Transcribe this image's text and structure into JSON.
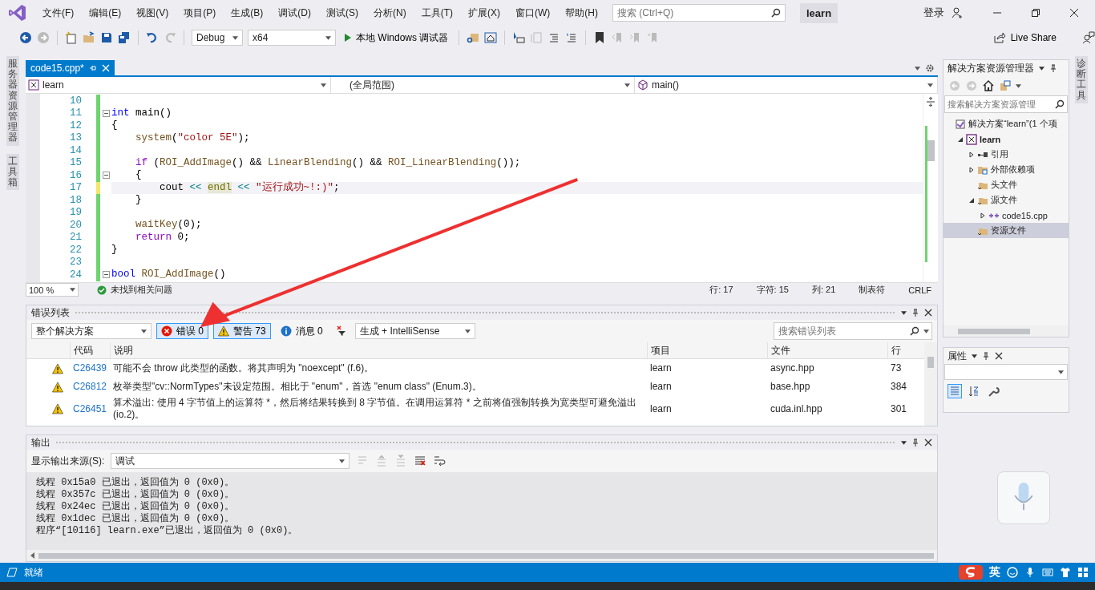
{
  "window": {
    "menu": [
      "文件(F)",
      "编辑(E)",
      "视图(V)",
      "项目(P)",
      "生成(B)",
      "调试(D)",
      "测试(S)",
      "分析(N)",
      "工具(T)",
      "扩展(X)",
      "窗口(W)",
      "帮助(H)"
    ],
    "search_placeholder": "搜索 (Ctrl+Q)",
    "title": "learn",
    "sign_in": "登录"
  },
  "toolbar": {
    "configuration": "Debug",
    "platform": "x64",
    "run_label": "本地 Windows 调试器",
    "live_share": "Live Share"
  },
  "side_tabs_left": [
    "服务器资源管理器",
    "工具箱"
  ],
  "side_tabs_right": [
    "诊断工具"
  ],
  "editor": {
    "tabs": [
      {
        "label": "code15.cpp*",
        "selected": true
      }
    ],
    "nav": {
      "project": "learn",
      "scope": "(全局范围)",
      "member": "main()"
    },
    "lines": [
      {
        "number": "10",
        "saved": true,
        "current": false,
        "fold": false
      },
      {
        "number": "11",
        "saved": true,
        "current": false,
        "fold": true,
        "tokens": [
          {
            "text": "int",
            "kind": "keyword"
          },
          {
            "text": " main()",
            "kind": "plain"
          }
        ]
      },
      {
        "number": "12",
        "saved": true,
        "current": false,
        "fold": false,
        "tokens": [
          {
            "text": "{",
            "kind": "plain"
          }
        ]
      },
      {
        "number": "13",
        "saved": true,
        "current": false,
        "fold": false,
        "tokens": [
          {
            "text": "    system",
            "kind": "func"
          },
          {
            "text": "(",
            "kind": "plain"
          },
          {
            "text": "\"color 5E\"",
            "kind": "string"
          },
          {
            "text": ");",
            "kind": "plain"
          }
        ]
      },
      {
        "number": "14",
        "saved": true,
        "current": false,
        "fold": false
      },
      {
        "number": "15",
        "saved": true,
        "current": false,
        "fold": false,
        "tokens": [
          {
            "text": "    if",
            "kind": "control"
          },
          {
            "text": " (",
            "kind": "plain"
          },
          {
            "text": "ROI_AddImage",
            "kind": "func"
          },
          {
            "text": "() && ",
            "kind": "plain"
          },
          {
            "text": "LinearBlending",
            "kind": "func"
          },
          {
            "text": "() && ",
            "kind": "plain"
          },
          {
            "text": "ROI_LinearBlending",
            "kind": "func"
          },
          {
            "text": "());",
            "kind": "plain"
          }
        ]
      },
      {
        "number": "16",
        "saved": true,
        "current": false,
        "fold": true,
        "tokens": [
          {
            "text": "    {",
            "kind": "plain"
          }
        ]
      },
      {
        "number": "17",
        "saved": false,
        "current": true,
        "fold": false,
        "tokens": [
          {
            "text": "        cout ",
            "kind": "plain"
          },
          {
            "text": "<< ",
            "kind": "operator"
          },
          {
            "text": "endl",
            "kind": "highlight"
          },
          {
            "text": " << ",
            "kind": "operator"
          },
          {
            "text": "\"运行成功~!:)\"",
            "kind": "string"
          },
          {
            "text": ";",
            "kind": "plain"
          }
        ]
      },
      {
        "number": "18",
        "saved": true,
        "current": false,
        "fold": false,
        "tokens": [
          {
            "text": "    }",
            "kind": "plain"
          }
        ]
      },
      {
        "number": "19",
        "saved": true,
        "current": false,
        "fold": false
      },
      {
        "number": "20",
        "saved": true,
        "current": false,
        "fold": false,
        "tokens": [
          {
            "text": "    waitKey",
            "kind": "func"
          },
          {
            "text": "(0);",
            "kind": "plain"
          }
        ]
      },
      {
        "number": "21",
        "saved": true,
        "current": false,
        "fold": false,
        "tokens": [
          {
            "text": "    return",
            "kind": "control"
          },
          {
            "text": " 0;",
            "kind": "plain"
          }
        ]
      },
      {
        "number": "22",
        "saved": true,
        "current": false,
        "fold": false,
        "tokens": [
          {
            "text": "}",
            "kind": "plain"
          }
        ]
      },
      {
        "number": "23",
        "saved": true,
        "current": false,
        "fold": false
      },
      {
        "number": "24",
        "saved": true,
        "current": false,
        "fold": true,
        "tokens": [
          {
            "text": "bool ",
            "kind": "keyword"
          },
          {
            "text": "ROI_AddImage",
            "kind": "func"
          },
          {
            "text": "()",
            "kind": "plain"
          }
        ]
      }
    ],
    "status": {
      "zoom": "100 %",
      "issues": "未找到相关问题",
      "line": "行: 17",
      "char": "字符: 15",
      "col": "列: 21",
      "tabs": "制表符",
      "eol": "CRLF"
    }
  },
  "error_list": {
    "title": "错误列表",
    "scope": "整个解决方案",
    "filters": [
      {
        "kind": "error",
        "label": "错误 0",
        "on": true
      },
      {
        "kind": "warning",
        "label": "警告 73",
        "on": true
      },
      {
        "kind": "message",
        "label": "消息 0",
        "on": false
      }
    ],
    "source": "生成 + IntelliSense",
    "search_placeholder": "搜索错误列表",
    "columns": [
      "代码",
      "说明",
      "项目",
      "文件",
      "行"
    ],
    "rows": [
      {
        "kind": "warning",
        "code": "C26439",
        "description": "可能不会 throw 此类型的函数。将其声明为 \"noexcept\" (f.6)。",
        "project": "learn",
        "file": "async.hpp",
        "line": "73"
      },
      {
        "kind": "warning",
        "code": "C26812",
        "description": "枚举类型\"cv::NormTypes\"未设定范围。相比于 \"enum\"，首选 \"enum class\" (Enum.3)。",
        "project": "learn",
        "file": "base.hpp",
        "line": "384"
      },
      {
        "kind": "warning",
        "code": "C26451",
        "description": "算术溢出: 使用 4 字节值上的运算符 *，然后将结果转换到 8 字节值。在调用运算符 * 之前将值强制转换为宽类型可避免溢出 (io.2)。",
        "project": "learn",
        "file": "cuda.inl.hpp",
        "line": "301"
      }
    ]
  },
  "output": {
    "title": "输出",
    "source_label": "显示输出来源(S):",
    "source": "调试",
    "lines": [
      "线程 0x15a0 已退出，返回值为 0 (0x0)。",
      "线程 0x357c 已退出，返回值为 0 (0x0)。",
      "线程 0x24ec 已退出，返回值为 0 (0x0)。",
      "线程 0x1dec 已退出，返回值为 0 (0x0)。",
      "程序“[10116] learn.exe”已退出，返回值为 0 (0x0)。"
    ]
  },
  "solution_explorer": {
    "title": "解决方案资源管理器",
    "search_placeholder": "搜索解决方案资源管理",
    "tree": [
      {
        "label": "解决方案“learn”(1 个项",
        "kind": "solution",
        "selected": false,
        "children": [
          {
            "label": "learn",
            "kind": "project",
            "selected": false,
            "expanded": true,
            "children": [
              {
                "label": "引用",
                "kind": "references",
                "selected": false,
                "expanded": false
              },
              {
                "label": "外部依赖项",
                "kind": "dependencies",
                "selected": false,
                "expanded": false
              },
              {
                "label": "头文件",
                "kind": "folder",
                "selected": false
              },
              {
                "label": "源文件",
                "kind": "folder",
                "selected": false,
                "expanded": true,
                "children": [
                  {
                    "label": "code15.cpp",
                    "kind": "cpp",
                    "selected": false,
                    "expanded": false
                  }
                ]
              },
              {
                "label": "资源文件",
                "kind": "folder",
                "selected": true
              }
            ]
          }
        ]
      }
    ]
  },
  "properties": {
    "title": "属性"
  },
  "status_bar": {
    "text": "就绪",
    "ime": "英"
  }
}
